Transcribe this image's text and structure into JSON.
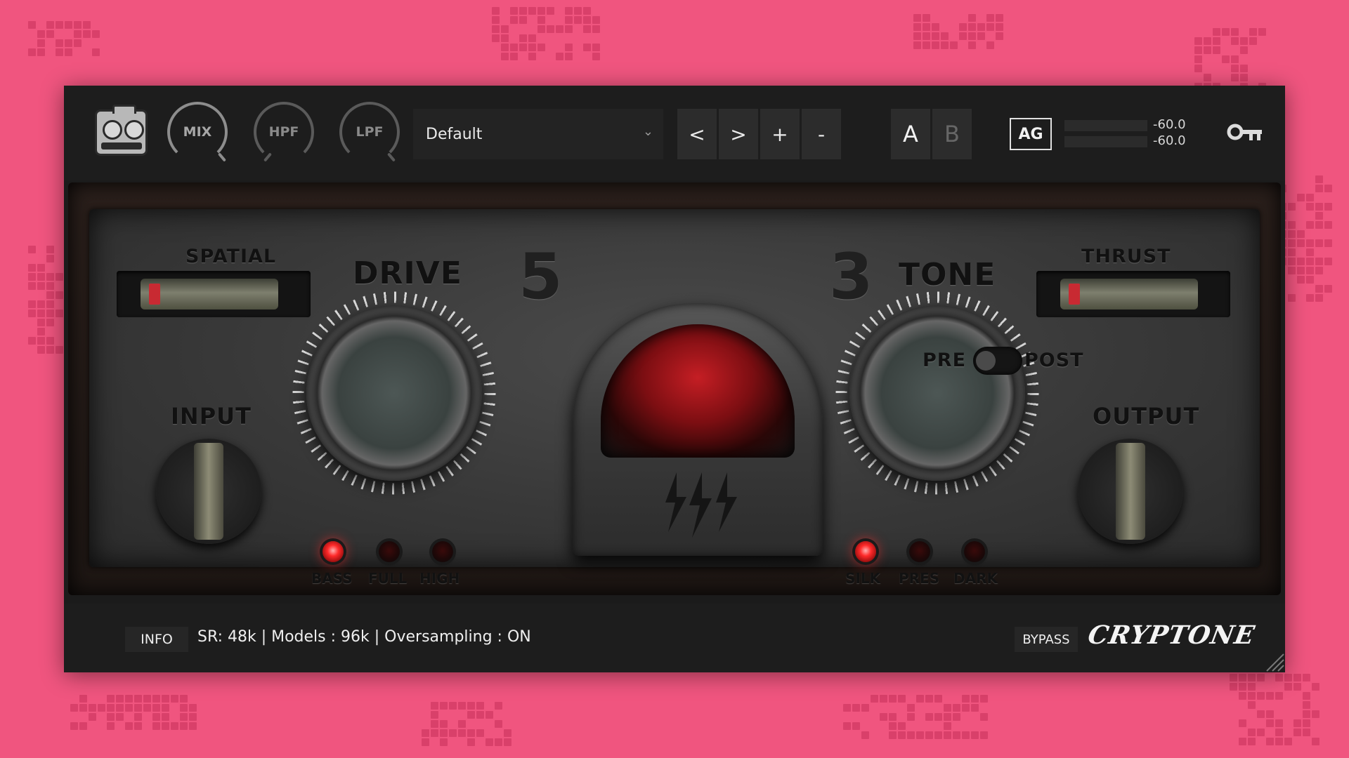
{
  "header": {
    "knobs": [
      {
        "label": "MIX"
      },
      {
        "label": "HPF"
      },
      {
        "label": "LPF"
      }
    ],
    "preset": {
      "name": "Default"
    },
    "nav_buttons": {
      "prev": "<",
      "next": ">",
      "add": "+",
      "remove": "-"
    },
    "ab": {
      "a": "A",
      "b": "B",
      "active": "A"
    },
    "ag_label": "AG",
    "meters": {
      "left": "-60.0",
      "right": "-60.0"
    },
    "icons": {
      "tape": "tape-recorder-icon",
      "key": "key-icon",
      "chevron": "chevron-down-icon"
    }
  },
  "panel": {
    "digit_left": "5",
    "digit_right": "3",
    "spatial_label": "SPATIAL",
    "thrust_label": "THRUST",
    "input_label": "INPUT",
    "output_label": "OUTPUT",
    "drive_label": "DRIVE",
    "tone_label": "TONE",
    "pre_label": "PRE",
    "post_label": "POST",
    "drive_modes": [
      {
        "label": "BASS",
        "on": true
      },
      {
        "label": "FULL",
        "on": false
      },
      {
        "label": "HIGH",
        "on": false
      }
    ],
    "tone_modes": [
      {
        "label": "SILK",
        "on": true
      },
      {
        "label": "PRES",
        "on": false
      },
      {
        "label": "DARK",
        "on": false
      }
    ]
  },
  "footer": {
    "info_label": "INFO",
    "status": "SR: 48k | Models : 96k | Oversampling : ON",
    "bypass_label": "BYPASS",
    "brand": "CRYPTONE"
  },
  "colors": {
    "background": "#f0557f",
    "led_on": "#ff2a2a",
    "chassis": "#1b1b1b"
  }
}
